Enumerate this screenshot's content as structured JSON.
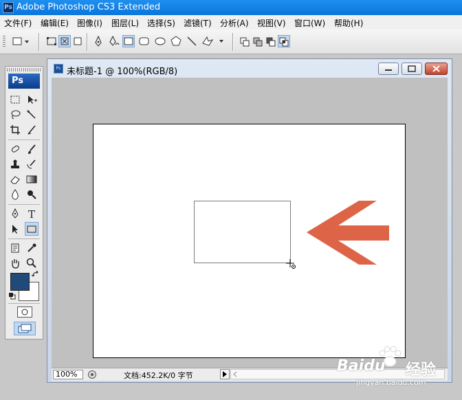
{
  "app": {
    "window_title": "Adobe Photoshop CS3 Extended",
    "logo_text": "Ps"
  },
  "menubar": {
    "items": [
      "文件(F)",
      "编辑(E)",
      "图像(I)",
      "图层(L)",
      "选择(S)",
      "滤镜(T)",
      "分析(A)",
      "视图(V)",
      "窗口(W)",
      "帮助(H)"
    ]
  },
  "options_bar": {
    "tool_preset_icon": "rectangle-tool-preset-icon",
    "mode_icons": [
      "shape-layers-icon",
      "paths-icon",
      "fill-pixels-icon"
    ],
    "shape_icons": [
      "pen-icon",
      "freeform-pen-icon",
      "rectangle-icon",
      "rounded-rectangle-icon",
      "ellipse-icon",
      "polygon-icon",
      "line-icon",
      "custom-shape-icon"
    ],
    "combine_icons": [
      "new-shape-area-icon",
      "add-to-shape-area-icon",
      "subtract-from-shape-area-icon",
      "intersect-shape-areas-icon"
    ],
    "selected": {
      "mode": "paths-icon",
      "shape": "rectangle-icon",
      "combine": "intersect-shape-areas-icon"
    }
  },
  "toolbox": {
    "logo_text": "Ps",
    "active_tool": "rectangle-tool",
    "colors": {
      "foreground": "#1f4a7a",
      "background": "#ffffff"
    }
  },
  "document": {
    "title": "未标题-1 @ 100%(RGB/8)",
    "status_zoom": "100%",
    "status_doc": "文档:452.2K/0 字节"
  },
  "annotation": {
    "arrow_color": "#dd6446"
  },
  "watermark": {
    "brand": "Baidu",
    "brand_cn": "经验",
    "url": "jingyan.baidu.com"
  },
  "colors": {
    "titlebar": "#0a74dc",
    "workspace": "#c0c0c0",
    "selected_button": "#c3d9f2",
    "close_button": "#c4412c"
  }
}
